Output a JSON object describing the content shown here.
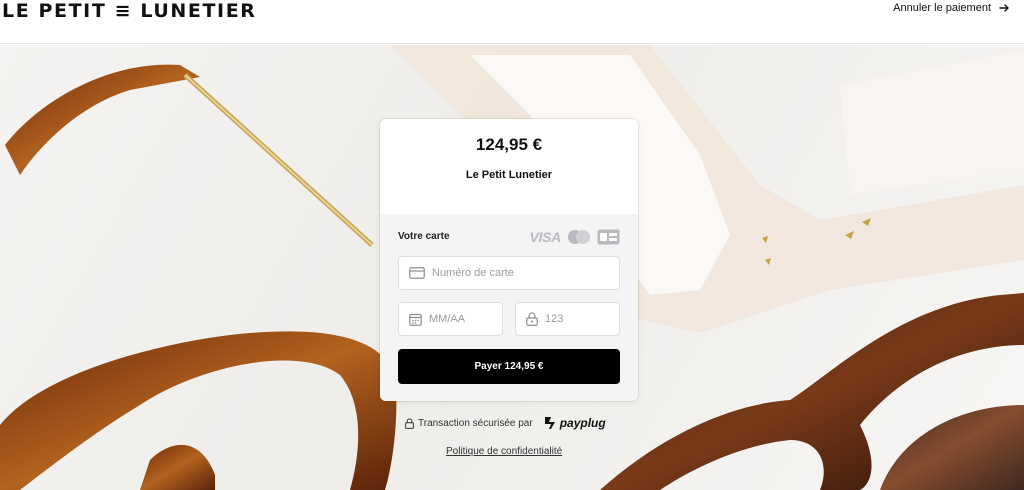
{
  "header": {
    "logo_text": "LE PETIT ≡ LUNETIER",
    "cancel_label": "Annuler le paiement",
    "cancel_icon": "arrow-right-icon"
  },
  "payment": {
    "amount": "124,95 €",
    "merchant": "Le Petit Lunetier",
    "card_label": "Votre carte",
    "brands": {
      "visa": "VISA"
    },
    "card_number": {
      "placeholder": "Numéro de carte",
      "value": ""
    },
    "expiry": {
      "placeholder": "MM/AA",
      "value": ""
    },
    "cvc": {
      "placeholder": "123",
      "value": ""
    },
    "pay_button_label": "Payer 124,95 €"
  },
  "footer": {
    "secure_text": "Transaction sécurisée par",
    "payplug_label": "payplug",
    "privacy_link": "Politique de confidentialité"
  },
  "colors": {
    "button_bg": "#000000",
    "card_body_bg": "#f4f4f5",
    "tortoise": "#8a3f12",
    "cream_frame": "#f1e6dc"
  }
}
